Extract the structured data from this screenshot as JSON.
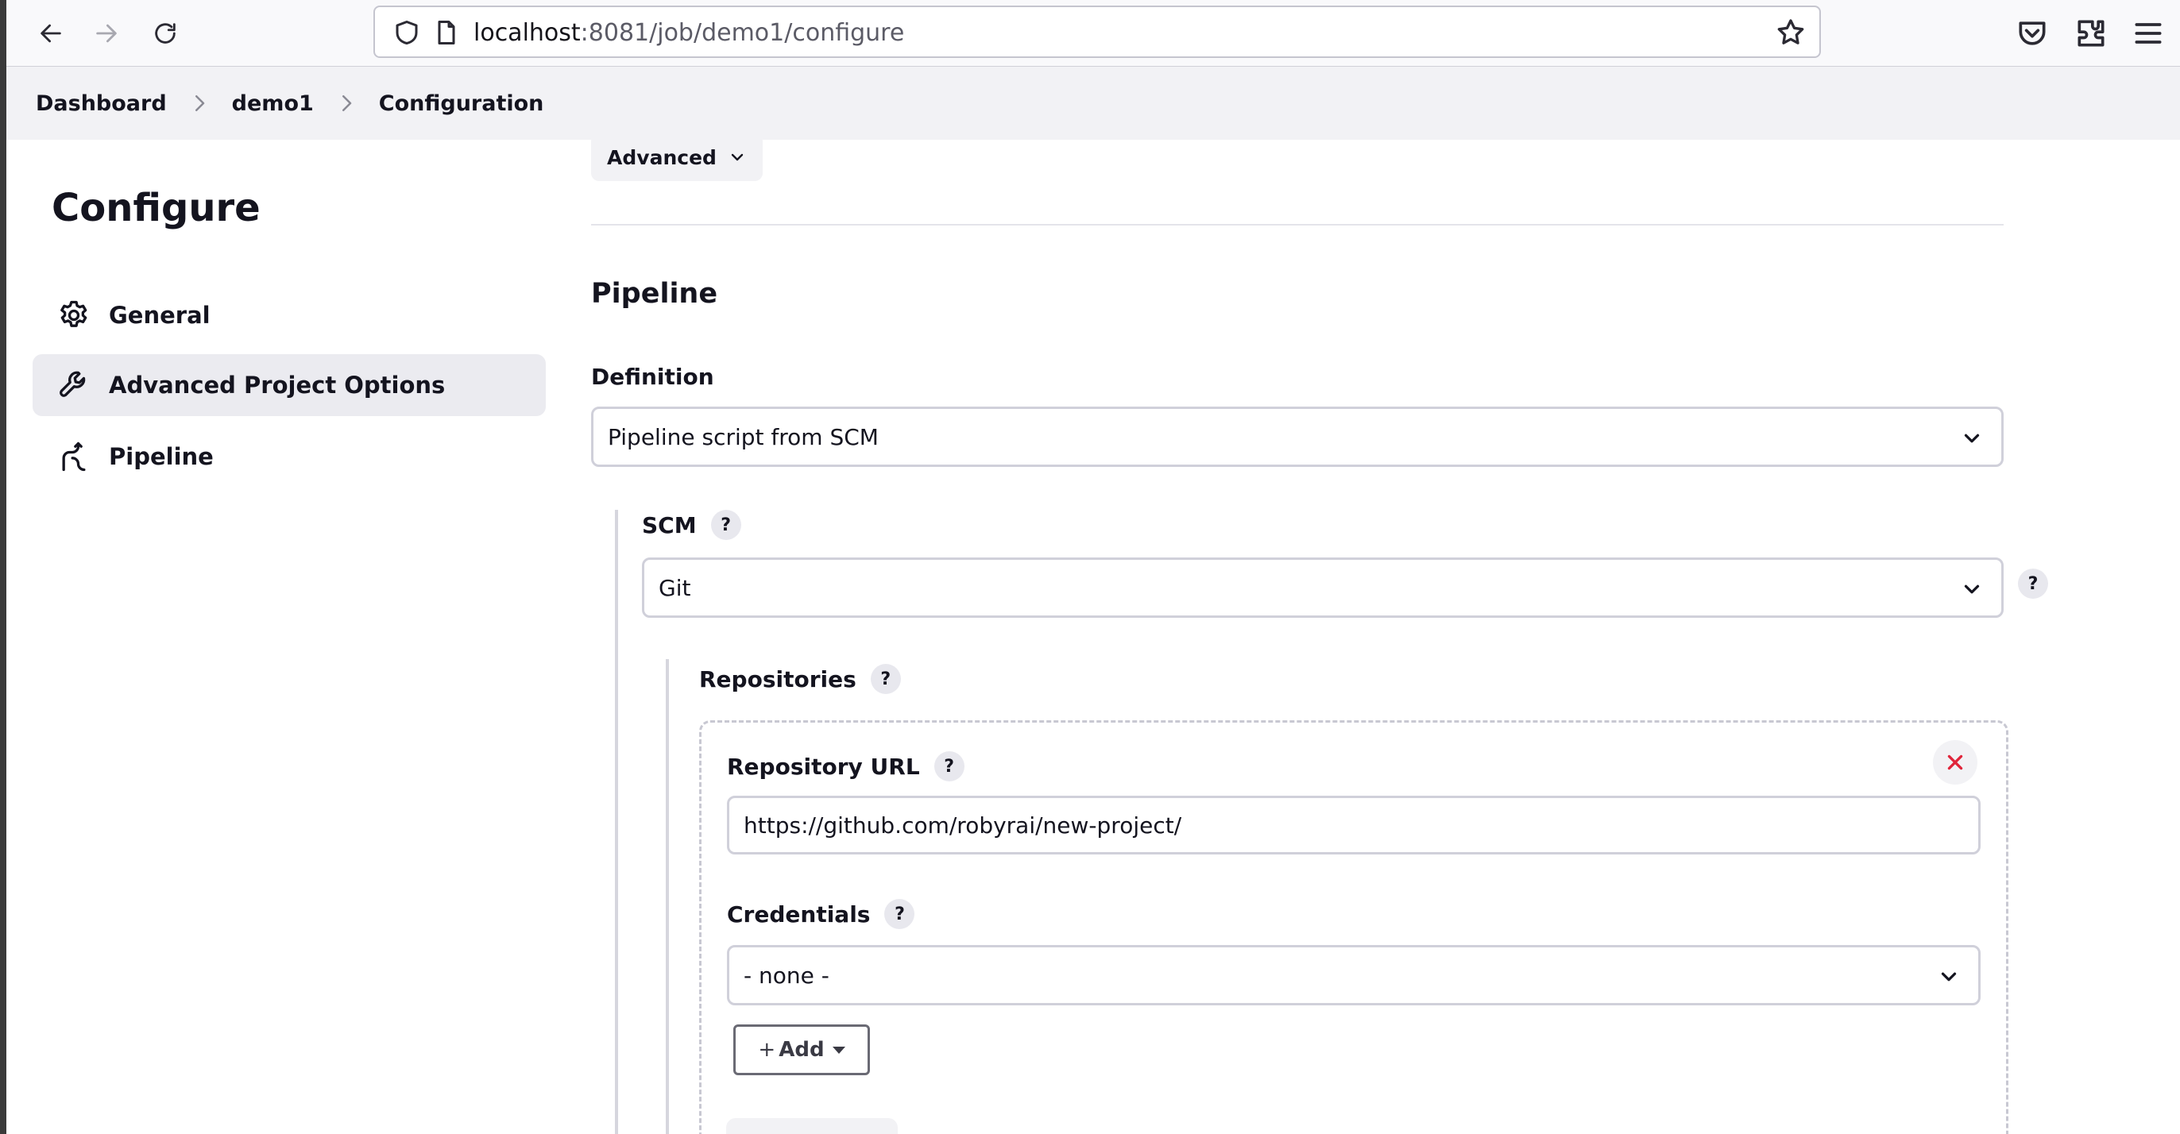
{
  "browser": {
    "url_host": "localhost",
    "url_rest": ":8081/job/demo1/configure"
  },
  "breadcrumb": [
    "Dashboard",
    "demo1",
    "Configuration"
  ],
  "sidebar": {
    "title": "Configure",
    "items": [
      {
        "label": "General",
        "icon": "gear-icon",
        "active": false
      },
      {
        "label": "Advanced Project Options",
        "icon": "wrench-icon",
        "active": true
      },
      {
        "label": "Pipeline",
        "icon": "pipeline-icon",
        "active": false
      }
    ]
  },
  "main": {
    "advanced_label": "Advanced",
    "section_title": "Pipeline",
    "definition": {
      "label": "Definition",
      "value": "Pipeline script from SCM"
    },
    "scm": {
      "label": "SCM",
      "help": "?",
      "value": "Git"
    },
    "repositories": {
      "label": "Repositories",
      "help": "?",
      "repo_url": {
        "label": "Repository URL",
        "help": "?",
        "value": "https://github.com/robyrai/new-project/"
      },
      "credentials": {
        "label": "Credentials",
        "help": "?",
        "value": "- none -"
      },
      "add_button": "Add"
    }
  }
}
